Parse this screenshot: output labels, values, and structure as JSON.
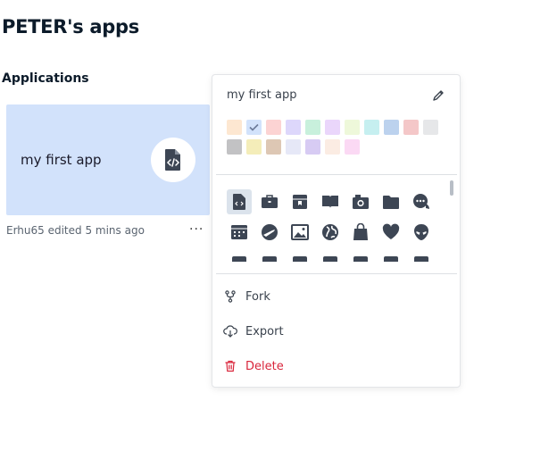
{
  "page": {
    "title": "PETER's apps",
    "section": "Applications"
  },
  "app": {
    "name": "my first app",
    "meta": "Erhu65 edited 5 mins ago",
    "more": "···",
    "icon": "code-file-icon",
    "color": "#d2e2fb"
  },
  "menu": {
    "app_name": "my first app",
    "swatch_colors": [
      "#fde7d1",
      "#d2e2fb",
      "#fcd3d3",
      "#ddd7fb",
      "#c8f0dc",
      "#ead6fb",
      "#eef8da",
      "#c6eff0",
      "#bcd2ee",
      "#f4c7c8",
      "#e6e7e9",
      "#c2c2c4",
      "#f4edb9",
      "#ddc7b4",
      "#e6e8f7",
      "#d7cbf3",
      "#fbece3",
      "#fbd9f4"
    ],
    "selected_swatch": 1,
    "selected_icon": 0,
    "icons": [
      "code-file-icon",
      "briefcase-icon",
      "inbox-archive-icon",
      "book-open-icon",
      "camera-icon",
      "folder-icon",
      "chat-bubble-icon",
      "calendar-icon",
      "airplane-globe-icon",
      "image-icon",
      "globe-icon",
      "shopping-bag-icon",
      "heart-icon",
      "alien-icon"
    ],
    "items": {
      "fork": "Fork",
      "export": "Export",
      "delete": "Delete"
    },
    "danger_color": "#d9253b"
  }
}
